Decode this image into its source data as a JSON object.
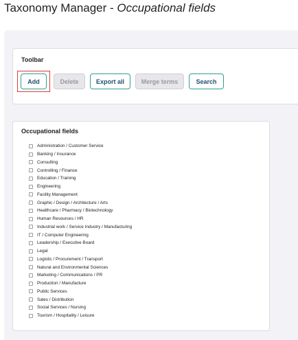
{
  "page": {
    "title_main": "Taxonomy Manager - ",
    "title_sub": "Occupational fields"
  },
  "colors": {
    "accent": "#2e9e92",
    "button_text": "#1f4f6b",
    "highlight": "#e03a3a",
    "backdrop": "#f3f3f7"
  },
  "toolbar": {
    "title": "Toolbar",
    "add_label": "Add",
    "delete_label": "Delete",
    "export_label": "Export all",
    "merge_label": "Merge terms",
    "search_label": "Search"
  },
  "fields": {
    "title": "Occupational fields",
    "items": [
      "Administration / Customer Service",
      "Banking / Insurance",
      "Consulting",
      "Controlling / Finance",
      "Education / Training",
      "Engineering",
      "Facility Management",
      "Graphic / Design / Architecture / Arts",
      "Healthcare / Pharmacy / Biotechnology",
      "Human Resources / HR",
      "Industrial work / Service Industry / Manufacturing",
      "IT / Computer Engineering",
      "Leadership / Executive Board",
      "Legal",
      "Logistic / Procurement / Transport",
      "Natural and Environmental Sciences",
      "Marketing / Communications / PR",
      "Production / Manufacture",
      "Public Services",
      "Sales / Distribution",
      "Social Services / Nursing",
      "Tourism / Hospitality / Leisure"
    ]
  }
}
